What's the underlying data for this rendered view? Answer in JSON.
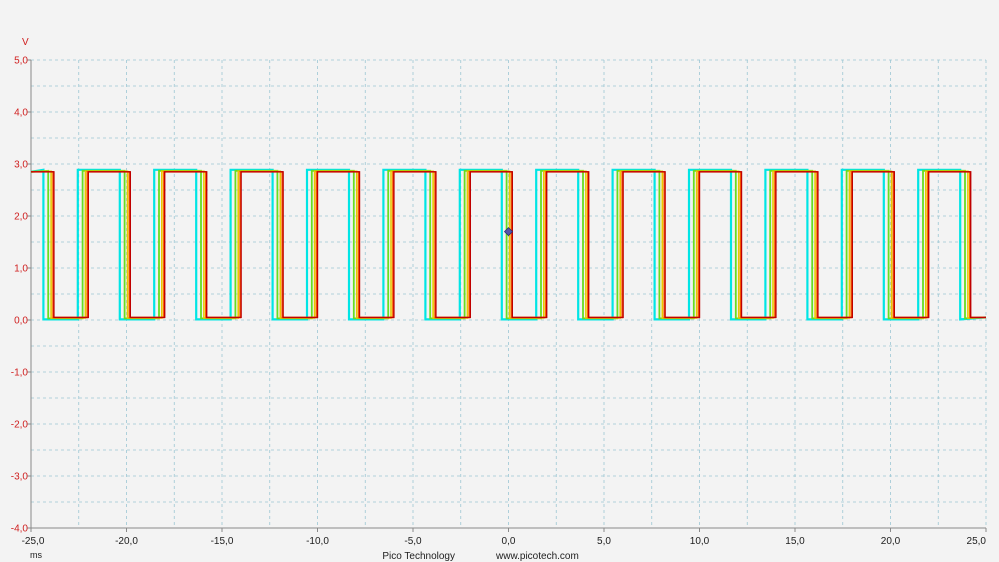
{
  "chart_data": {
    "type": "line",
    "title": "",
    "xlabel": "ms",
    "ylabel": "V",
    "xlim": [
      -25.0,
      25.0
    ],
    "ylim": [
      -4.0,
      5.0
    ],
    "x_ticks": [
      "-25,0",
      "-20,0",
      "-15,0",
      "-10,0",
      "-5,0",
      "0,0",
      "5,0",
      "10,0",
      "15,0",
      "20,0",
      "25,0"
    ],
    "x_tick_values": [
      -25,
      -20,
      -15,
      -10,
      -5,
      0,
      5,
      10,
      15,
      20,
      25
    ],
    "y_ticks": [
      "5,0",
      "4,0",
      "3,0",
      "2,0",
      "1,0",
      "0,0",
      "-1,0",
      "-2,0",
      "-3,0",
      "-4,0"
    ],
    "y_tick_values": [
      5,
      4,
      3,
      2,
      1,
      0,
      -1,
      -2,
      -3,
      -4
    ],
    "grid": true,
    "signal": {
      "waveform": "square",
      "high_v": 2.85,
      "low_v": 0.05,
      "period_ms": 4.0,
      "high_duration_ms": 2.2,
      "rising_edge_ms": -2.0,
      "persistence_colors": [
        "#00e5e5",
        "#66dd22",
        "#e8c800",
        "#ff6600",
        "#c00000"
      ]
    },
    "trigger": {
      "time_ms": 0.0,
      "level_v": 1.7,
      "color": "#5555aa"
    }
  },
  "footer": {
    "brand": "Pico Technology",
    "url": "www.picotech.com"
  }
}
